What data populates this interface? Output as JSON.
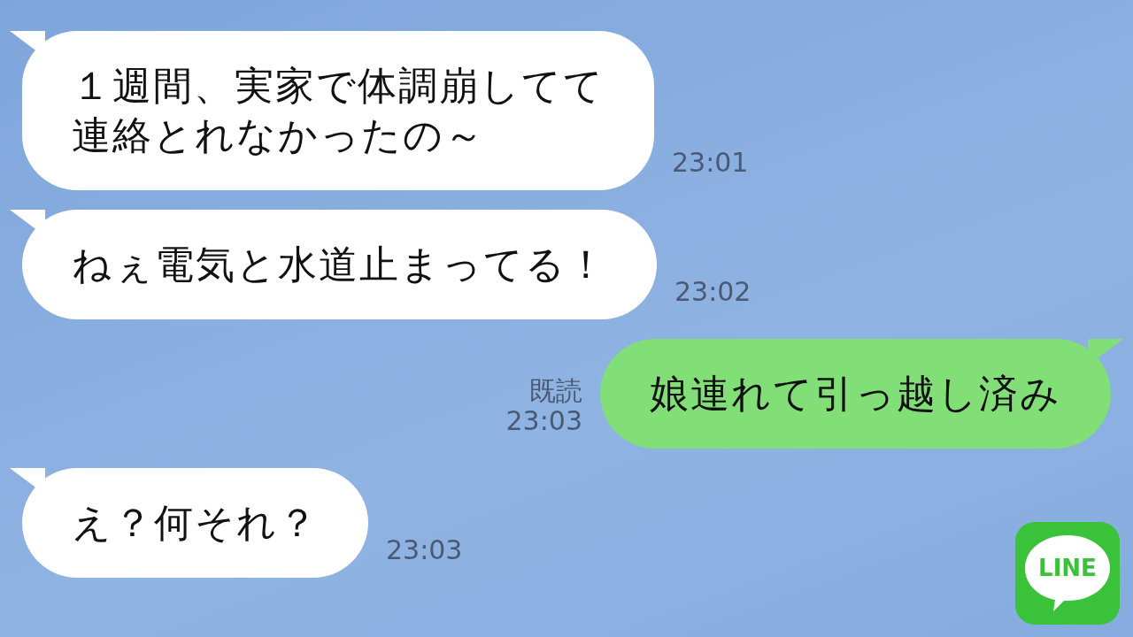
{
  "messages": [
    {
      "kind": "incoming",
      "lines": [
        "１週間、実家で体調崩してて",
        "連絡とれなかったの～"
      ],
      "time": "23:01"
    },
    {
      "kind": "incoming",
      "lines": [
        "ねぇ電気と水道止まってる！"
      ],
      "time": "23:02"
    },
    {
      "kind": "outgoing",
      "lines": [
        "娘連れて引っ越し済み"
      ],
      "read": "既読",
      "time": "23:03"
    },
    {
      "kind": "incoming",
      "lines": [
        "え？何それ？"
      ],
      "time": "23:03"
    }
  ],
  "logo": {
    "text": "LINE"
  }
}
